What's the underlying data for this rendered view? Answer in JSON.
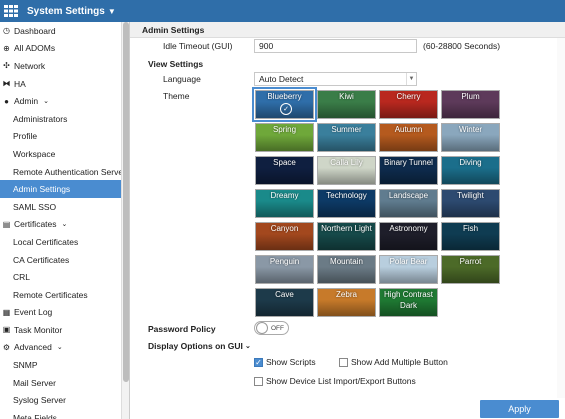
{
  "app": {
    "title": "System Settings"
  },
  "sidebar": {
    "items": [
      {
        "label": "Dashboard",
        "icon": "dashboard-icon"
      },
      {
        "label": "All ADOMs",
        "icon": "globe-icon"
      },
      {
        "label": "Network",
        "icon": "network-icon"
      },
      {
        "label": "HA",
        "icon": "ha-icon"
      },
      {
        "label": "Admin",
        "icon": "user-icon",
        "expanded": true
      },
      {
        "label": "Administrators",
        "sub": true
      },
      {
        "label": "Profile",
        "sub": true
      },
      {
        "label": "Workspace",
        "sub": true
      },
      {
        "label": "Remote Authentication Server",
        "sub": true
      },
      {
        "label": "Admin Settings",
        "sub": true,
        "active": true
      },
      {
        "label": "SAML SSO",
        "sub": true
      },
      {
        "label": "Certificates",
        "icon": "certificate-icon",
        "expanded": true
      },
      {
        "label": "Local Certificates",
        "sub": true
      },
      {
        "label": "CA Certificates",
        "sub": true
      },
      {
        "label": "CRL",
        "sub": true
      },
      {
        "label": "Remote Certificates",
        "sub": true
      },
      {
        "label": "Event Log",
        "icon": "event-log-icon"
      },
      {
        "label": "Task Monitor",
        "icon": "task-monitor-icon"
      },
      {
        "label": "Advanced",
        "icon": "advanced-icon",
        "expanded": true
      },
      {
        "label": "SNMP",
        "sub": true
      },
      {
        "label": "Mail Server",
        "sub": true
      },
      {
        "label": "Syslog Server",
        "sub": true
      },
      {
        "label": "Meta Fields",
        "sub": true
      }
    ]
  },
  "main": {
    "header": "Admin Settings",
    "idle_timeout": {
      "label": "Idle Timeout (GUI)",
      "value": "900",
      "hint": "(60-28800 Seconds)"
    },
    "view_settings": {
      "title": "View Settings",
      "language_label": "Language",
      "language_value": "Auto Detect",
      "theme_label": "Theme"
    },
    "themes": [
      {
        "name": "Blueberry",
        "color": "#2f6ea9",
        "selected": true
      },
      {
        "name": "Kiwi",
        "color": "#3a7d48"
      },
      {
        "name": "Cherry",
        "color": "#b9281f"
      },
      {
        "name": "Plum",
        "color": "#5d3a5a"
      },
      {
        "name": "Spring",
        "color": "#6fa83a"
      },
      {
        "name": "Summer",
        "color": "#3a7f9c"
      },
      {
        "name": "Autumn",
        "color": "#b55a1e"
      },
      {
        "name": "Winter",
        "color": "#8aa7bd"
      },
      {
        "name": "Space",
        "color": "#0f1f40"
      },
      {
        "name": "Calla Lily",
        "color": "#cfd6c8"
      },
      {
        "name": "Binary Tunnel",
        "color": "#0e2c4e"
      },
      {
        "name": "Diving",
        "color": "#1b6e8b"
      },
      {
        "name": "Dreamy",
        "color": "#1a8a8a"
      },
      {
        "name": "Technology",
        "color": "#0d3a66"
      },
      {
        "name": "Landscape",
        "color": "#607c8f"
      },
      {
        "name": "Twilight",
        "color": "#2d4a70"
      },
      {
        "name": "Canyon",
        "color": "#a3481e"
      },
      {
        "name": "Northern Light",
        "color": "#164a4a"
      },
      {
        "name": "Astronomy",
        "color": "#1e1e2a"
      },
      {
        "name": "Fish",
        "color": "#0f3c52"
      },
      {
        "name": "Penguin",
        "color": "#8a98a6"
      },
      {
        "name": "Mountain",
        "color": "#6b7b86"
      },
      {
        "name": "Polar Bear",
        "color": "#b8cede"
      },
      {
        "name": "Parrot",
        "color": "#4c6a28"
      },
      {
        "name": "Cave",
        "color": "#1d3a4a"
      },
      {
        "name": "Zebra",
        "color": "#c77a2a"
      },
      {
        "name": "High Contrast Dark",
        "color": "#1f7a33"
      }
    ],
    "password_policy": {
      "label": "Password Policy",
      "toggle_text": "OFF"
    },
    "display_options": {
      "title": "Display Options on GUI",
      "show_scripts": "Show Scripts",
      "show_add_multiple": "Show Add Multiple Button",
      "show_device_list": "Show Device List Import/Export Buttons"
    },
    "apply_label": "Apply"
  },
  "colors": {
    "accent": "#4a8cd0",
    "topbar": "#2f6ea9"
  }
}
